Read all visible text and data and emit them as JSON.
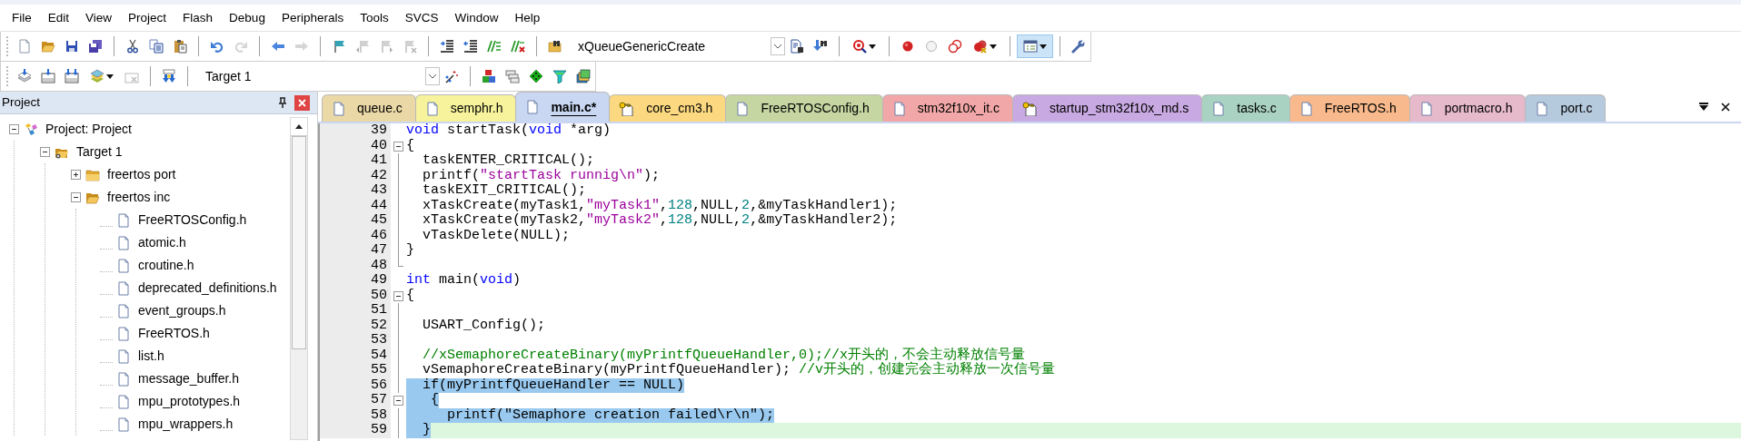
{
  "menu": [
    {
      "label": "File"
    },
    {
      "label": "Edit"
    },
    {
      "label": "View"
    },
    {
      "label": "Project"
    },
    {
      "label": "Flash"
    },
    {
      "label": "Debug"
    },
    {
      "label": "Peripherals"
    },
    {
      "label": "Tools"
    },
    {
      "label": "SVCS"
    },
    {
      "label": "Window"
    },
    {
      "label": "Help"
    }
  ],
  "toolbar_1": [
    {
      "kind": "button",
      "disabled": false,
      "menu": false,
      "pressed": false
    },
    {
      "kind": "button",
      "disabled": false,
      "menu": false,
      "pressed": false
    },
    {
      "kind": "button",
      "disabled": false,
      "menu": false,
      "pressed": false
    },
    {
      "kind": "button",
      "disabled": false,
      "menu": false,
      "pressed": false
    },
    {
      "kind": "separator"
    },
    {
      "kind": "button",
      "disabled": false,
      "menu": false,
      "pressed": false
    },
    {
      "kind": "button",
      "disabled": false,
      "menu": false,
      "pressed": false
    },
    {
      "kind": "button",
      "disabled": false,
      "menu": false,
      "pressed": false
    },
    {
      "kind": "separator"
    },
    {
      "kind": "button",
      "disabled": false,
      "menu": false,
      "pressed": false
    },
    {
      "kind": "button",
      "disabled": true,
      "menu": false,
      "pressed": false
    },
    {
      "kind": "separator"
    },
    {
      "kind": "button",
      "disabled": false,
      "menu": false,
      "pressed": false
    },
    {
      "kind": "button",
      "disabled": true,
      "menu": false,
      "pressed": false
    },
    {
      "kind": "separator"
    },
    {
      "kind": "button",
      "disabled": false,
      "menu": false,
      "pressed": false
    },
    {
      "kind": "button",
      "disabled": true,
      "menu": false,
      "pressed": false
    },
    {
      "kind": "button",
      "disabled": true,
      "menu": false,
      "pressed": false
    },
    {
      "kind": "button",
      "disabled": true,
      "menu": false,
      "pressed": false
    },
    {
      "kind": "separator"
    },
    {
      "kind": "button",
      "disabled": false,
      "menu": false,
      "pressed": false
    },
    {
      "kind": "button",
      "disabled": false,
      "menu": false,
      "pressed": false
    },
    {
      "kind": "button",
      "disabled": false,
      "menu": false,
      "pressed": false
    },
    {
      "kind": "button",
      "disabled": false,
      "menu": false,
      "pressed": false
    },
    {
      "kind": "separator"
    },
    {
      "kind": "button",
      "disabled": false,
      "menu": false,
      "pressed": false
    },
    {
      "kind": "combo",
      "value": "xQueueGenericCreate"
    },
    {
      "kind": "button",
      "disabled": false,
      "menu": false,
      "pressed": false
    },
    {
      "kind": "button",
      "disabled": false,
      "menu": false,
      "pressed": false
    },
    {
      "kind": "separator"
    },
    {
      "kind": "button",
      "disabled": false,
      "menu": true,
      "pressed": false
    },
    {
      "kind": "separator"
    },
    {
      "kind": "button",
      "disabled": false,
      "menu": false,
      "pressed": false
    },
    {
      "kind": "button",
      "disabled": false,
      "menu": false,
      "pressed": false
    },
    {
      "kind": "button",
      "disabled": false,
      "menu": false,
      "pressed": false
    },
    {
      "kind": "button",
      "disabled": false,
      "menu": true,
      "pressed": false
    },
    {
      "kind": "separator"
    },
    {
      "kind": "button",
      "disabled": false,
      "menu": true,
      "pressed": true
    },
    {
      "kind": "separator"
    },
    {
      "kind": "button",
      "disabled": false,
      "menu": false,
      "pressed": false
    }
  ],
  "toolbar_2": [
    {
      "kind": "button",
      "disabled": false,
      "menu": false,
      "pressed": false
    },
    {
      "kind": "button",
      "disabled": false,
      "menu": false,
      "pressed": false
    },
    {
      "kind": "button",
      "disabled": false,
      "menu": false,
      "pressed": false
    },
    {
      "kind": "button",
      "disabled": false,
      "menu": true,
      "pressed": false
    },
    {
      "kind": "button",
      "disabled": true,
      "menu": false,
      "pressed": false
    },
    {
      "kind": "separator"
    },
    {
      "kind": "button",
      "disabled": false,
      "menu": false,
      "pressed": false
    },
    {
      "kind": "separator"
    },
    {
      "kind": "combo",
      "value": "Target 1"
    },
    {
      "kind": "button",
      "disabled": false,
      "menu": false,
      "pressed": false
    },
    {
      "kind": "separator"
    },
    {
      "kind": "button",
      "disabled": false,
      "menu": false,
      "pressed": false
    },
    {
      "kind": "button",
      "disabled": false,
      "menu": false,
      "pressed": false
    },
    {
      "kind": "button",
      "disabled": false,
      "menu": false,
      "pressed": false
    },
    {
      "kind": "button",
      "disabled": false,
      "menu": false,
      "pressed": false
    },
    {
      "kind": "button",
      "disabled": false,
      "menu": false,
      "pressed": false
    }
  ],
  "project_panel": {
    "title": "Project",
    "tree": [
      {
        "label": "Project: Project",
        "kind": "project",
        "expanded": true,
        "children": [
          {
            "label": "Target 1",
            "kind": "target",
            "expanded": true,
            "children": [
              {
                "label": "freertos port",
                "kind": "folder",
                "expanded": false
              },
              {
                "label": "freertos inc",
                "kind": "folder",
                "expanded": true,
                "children": [
                  {
                    "label": "FreeRTOSConfig.h",
                    "kind": "file"
                  },
                  {
                    "label": "atomic.h",
                    "kind": "file"
                  },
                  {
                    "label": "croutine.h",
                    "kind": "file"
                  },
                  {
                    "label": "deprecated_definitions.h",
                    "kind": "file"
                  },
                  {
                    "label": "event_groups.h",
                    "kind": "file"
                  },
                  {
                    "label": "FreeRTOS.h",
                    "kind": "file"
                  },
                  {
                    "label": "list.h",
                    "kind": "file"
                  },
                  {
                    "label": "message_buffer.h",
                    "kind": "file"
                  },
                  {
                    "label": "mpu_prototypes.h",
                    "kind": "file"
                  },
                  {
                    "label": "mpu_wrappers.h",
                    "kind": "file"
                  }
                ]
              }
            ]
          }
        ]
      }
    ]
  },
  "tabs": [
    {
      "label": "queue.c",
      "kind": "file",
      "color": "#ead8a6",
      "selected": false
    },
    {
      "label": "semphr.h",
      "kind": "file",
      "color": "#f6f39c",
      "selected": false
    },
    {
      "label": "main.c*",
      "kind": "file",
      "color": "#c9d7f2",
      "selected": true
    },
    {
      "label": "core_cm3.h",
      "kind": "locked-file",
      "color": "#fcd980",
      "selected": false
    },
    {
      "label": "FreeRTOSConfig.h",
      "kind": "file",
      "color": "#c6d6a2",
      "selected": false
    },
    {
      "label": "stm32f10x_it.c",
      "kind": "file",
      "color": "#f1a7a7",
      "selected": false
    },
    {
      "label": "startup_stm32f10x_md.s",
      "kind": "locked-file",
      "color": "#c8a9e2",
      "selected": false
    },
    {
      "label": "tasks.c",
      "kind": "file",
      "color": "#a9d2c2",
      "selected": false
    },
    {
      "label": "FreeRTOS.h",
      "kind": "file",
      "color": "#f8ba8c",
      "selected": false
    },
    {
      "label": "portmacro.h",
      "kind": "file",
      "color": "#e6b9cb",
      "selected": false
    },
    {
      "label": "port.c",
      "kind": "file",
      "color": "#b6cadd",
      "selected": false
    }
  ],
  "editor": {
    "lines": [
      {
        "number": "39",
        "kind": "plain",
        "selected": false,
        "current": false,
        "segments": [
          {
            "kind": "keyword",
            "text": "void"
          },
          {
            "kind": "plain",
            "text": " startTask("
          },
          {
            "kind": "keyword",
            "text": "void"
          },
          {
            "kind": "plain",
            "text": " *arg)"
          }
        ]
      },
      {
        "number": "40",
        "kind": "fold-start",
        "selected": false,
        "current": false,
        "segments": [
          {
            "kind": "plain",
            "text": "{"
          }
        ]
      },
      {
        "number": "41",
        "kind": "fold-inside",
        "selected": false,
        "current": false,
        "segments": [
          {
            "kind": "plain",
            "text": "  taskENTER_CRITICAL();"
          }
        ]
      },
      {
        "number": "42",
        "kind": "fold-inside",
        "selected": false,
        "current": false,
        "segments": [
          {
            "kind": "plain",
            "text": "  printf("
          },
          {
            "kind": "string",
            "text": "\"startTask runnig\\n\""
          },
          {
            "kind": "plain",
            "text": ");"
          }
        ]
      },
      {
        "number": "43",
        "kind": "fold-inside",
        "selected": false,
        "current": false,
        "segments": [
          {
            "kind": "plain",
            "text": "  taskEXIT_CRITICAL();"
          }
        ]
      },
      {
        "number": "44",
        "kind": "fold-inside",
        "selected": false,
        "current": false,
        "segments": [
          {
            "kind": "plain",
            "text": "  xTaskCreate(myTask1,"
          },
          {
            "kind": "string",
            "text": "\"myTask1\""
          },
          {
            "kind": "plain",
            "text": ","
          },
          {
            "kind": "number",
            "text": "128"
          },
          {
            "kind": "plain",
            "text": ",NULL,"
          },
          {
            "kind": "number",
            "text": "2"
          },
          {
            "kind": "plain",
            "text": ",&myTaskHandler1);"
          }
        ]
      },
      {
        "number": "45",
        "kind": "fold-inside",
        "selected": false,
        "current": false,
        "segments": [
          {
            "kind": "plain",
            "text": "  xTaskCreate(myTask2,"
          },
          {
            "kind": "string",
            "text": "\"myTask2\""
          },
          {
            "kind": "plain",
            "text": ","
          },
          {
            "kind": "number",
            "text": "128"
          },
          {
            "kind": "plain",
            "text": ",NULL,"
          },
          {
            "kind": "number",
            "text": "2"
          },
          {
            "kind": "plain",
            "text": ",&myTaskHandler2);"
          }
        ]
      },
      {
        "number": "46",
        "kind": "fold-inside",
        "selected": false,
        "current": false,
        "segments": [
          {
            "kind": "plain",
            "text": "  vTaskDelete(NULL);"
          }
        ]
      },
      {
        "number": "47",
        "kind": "fold-inside",
        "selected": false,
        "current": false,
        "segments": [
          {
            "kind": "plain",
            "text": "}"
          }
        ]
      },
      {
        "number": "48",
        "kind": "fold-end",
        "selected": false,
        "current": false
      },
      {
        "number": "49",
        "kind": "plain",
        "selected": false,
        "current": false,
        "segments": [
          {
            "kind": "keyword",
            "text": "int"
          },
          {
            "kind": "plain",
            "text": " main("
          },
          {
            "kind": "keyword",
            "text": "void"
          },
          {
            "kind": "plain",
            "text": ")"
          }
        ]
      },
      {
        "number": "50",
        "kind": "fold-start",
        "selected": false,
        "current": false,
        "segments": [
          {
            "kind": "plain",
            "text": "{"
          }
        ]
      },
      {
        "number": "51",
        "kind": "fold-inside",
        "selected": false,
        "current": false
      },
      {
        "number": "52",
        "kind": "fold-inside",
        "selected": false,
        "current": false,
        "segments": [
          {
            "kind": "plain",
            "text": "  USART_Config();"
          }
        ]
      },
      {
        "number": "53",
        "kind": "fold-inside",
        "selected": false,
        "current": false
      },
      {
        "number": "54",
        "kind": "fold-inside",
        "selected": false,
        "current": false,
        "segments": [
          {
            "kind": "comment",
            "text": "  //xSemaphoreCreateBinary(myPrintfQueueHandler,0);//x开头的，不会主动释放信号量"
          }
        ]
      },
      {
        "number": "55",
        "kind": "fold-inside",
        "selected": false,
        "current": false,
        "segments": [
          {
            "kind": "plain",
            "text": "  vSemaphoreCreateBinary(myPrintfQueueHandler); "
          },
          {
            "kind": "comment",
            "text": "//v开头的，创建完会主动释放一次信号量"
          }
        ]
      },
      {
        "number": "56",
        "kind": "fold-inside",
        "selected": true,
        "current": false,
        "segments": [
          {
            "kind": "plain",
            "text": "  if(myPrintfQueueHandler == NULL)"
          }
        ]
      },
      {
        "number": "57",
        "kind": "fold-start",
        "selected": true,
        "current": false,
        "segments": [
          {
            "kind": "plain",
            "text": "   {"
          }
        ]
      },
      {
        "number": "58",
        "kind": "fold-inside",
        "selected": true,
        "current": false,
        "segments": [
          {
            "kind": "plain",
            "text": "     printf(\"Semaphore creation failed\\r\\n\");"
          }
        ]
      },
      {
        "number": "59",
        "kind": "fold-inside",
        "selected": true,
        "current": true,
        "segments": [
          {
            "kind": "plain",
            "text": "  }"
          }
        ]
      }
    ]
  }
}
